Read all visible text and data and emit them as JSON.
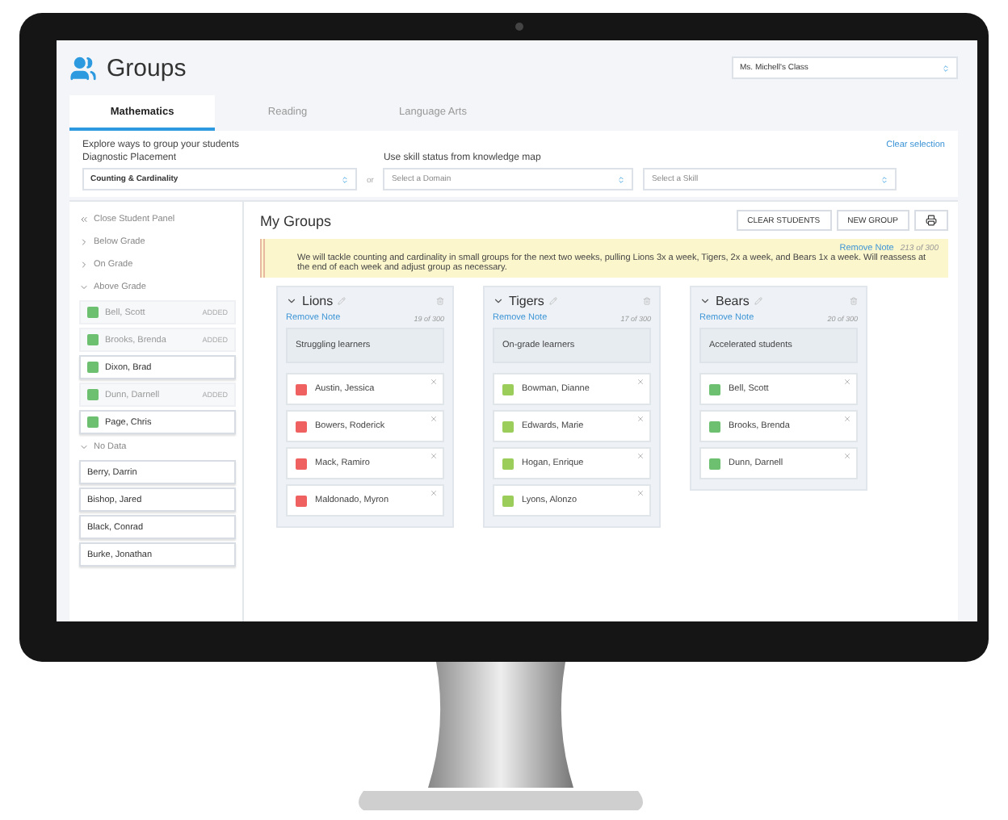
{
  "header": {
    "title": "Groups",
    "class_select": "Ms. Michell's Class"
  },
  "tabs": [
    {
      "label": "Mathematics",
      "selected": true
    },
    {
      "label": "Reading",
      "selected": false
    },
    {
      "label": "Language Arts",
      "selected": false
    }
  ],
  "filters": {
    "heading": "Explore ways to group your students",
    "clear_link": "Clear selection",
    "placement_label": "Diagnostic Placement",
    "placement_value": "Counting & Cardinality",
    "or_label": "or",
    "skill_label": "Use skill status from knowledge map",
    "domain_placeholder": "Select a Domain",
    "skill_placeholder": "Select a Skill"
  },
  "student_panel": {
    "close_label": "Close Student Panel",
    "categories": [
      {
        "label": "Below Grade",
        "expanded": false
      },
      {
        "label": "On Grade",
        "expanded": false
      },
      {
        "label": "Above Grade",
        "expanded": true,
        "students": [
          {
            "name": "Bell, Scott",
            "color": "#6cc070",
            "added": true,
            "badge": "ADDED"
          },
          {
            "name": "Brooks, Brenda",
            "color": "#6cc070",
            "added": true,
            "badge": "ADDED"
          },
          {
            "name": "Dixon, Brad",
            "color": "#6cc070",
            "added": false
          },
          {
            "name": "Dunn, Darnell",
            "color": "#6cc070",
            "added": true,
            "badge": "ADDED"
          },
          {
            "name": "Page, Chris",
            "color": "#6cc070",
            "added": false
          }
        ]
      },
      {
        "label": "No Data",
        "expanded": true,
        "students": [
          {
            "name": "Berry, Darrin",
            "added": false
          },
          {
            "name": "Bishop, Jared",
            "added": false
          },
          {
            "name": "Black, Conrad",
            "added": false
          },
          {
            "name": "Burke, Jonathan",
            "added": false
          }
        ]
      }
    ]
  },
  "my_groups": {
    "title": "My Groups",
    "buttons": [
      "CLEAR STUDENTS",
      "NEW GROUP"
    ],
    "note": {
      "remove_link": "Remove Note",
      "count": "213 of 300",
      "text": "We will tackle counting and cardinality in small groups for the next two weeks, pulling Lions 3x a week, Tigers, 2x a week, and Bears 1x a week. Will reassess at the end of each week and adjust group as necessary."
    },
    "groups": [
      {
        "name": "Lions",
        "remove_link": "Remove Note",
        "count": "19 of 300",
        "note": "Struggling learners",
        "students": [
          {
            "name": "Austin, Jessica",
            "color": "#ee6160"
          },
          {
            "name": "Bowers, Roderick",
            "color": "#ee6160"
          },
          {
            "name": "Mack, Ramiro",
            "color": "#ee6160"
          },
          {
            "name": "Maldonado, Myron",
            "color": "#ee6160"
          }
        ]
      },
      {
        "name": "Tigers",
        "remove_link": "Remove Note",
        "count": "17 of 300",
        "note": "On-grade learners",
        "students": [
          {
            "name": "Bowman, Dianne",
            "color": "#9acd5a"
          },
          {
            "name": "Edwards, Marie",
            "color": "#9acd5a"
          },
          {
            "name": "Hogan, Enrique",
            "color": "#9acd5a"
          },
          {
            "name": "Lyons, Alonzo",
            "color": "#9acd5a"
          }
        ]
      },
      {
        "name": "Bears",
        "remove_link": "Remove Note",
        "count": "20 of 300",
        "note": "Accelerated students",
        "students": [
          {
            "name": "Bell, Scott",
            "color": "#6cc070"
          },
          {
            "name": "Brooks, Brenda",
            "color": "#6cc070"
          },
          {
            "name": "Dunn, Darnell",
            "color": "#6cc070"
          }
        ]
      }
    ]
  }
}
